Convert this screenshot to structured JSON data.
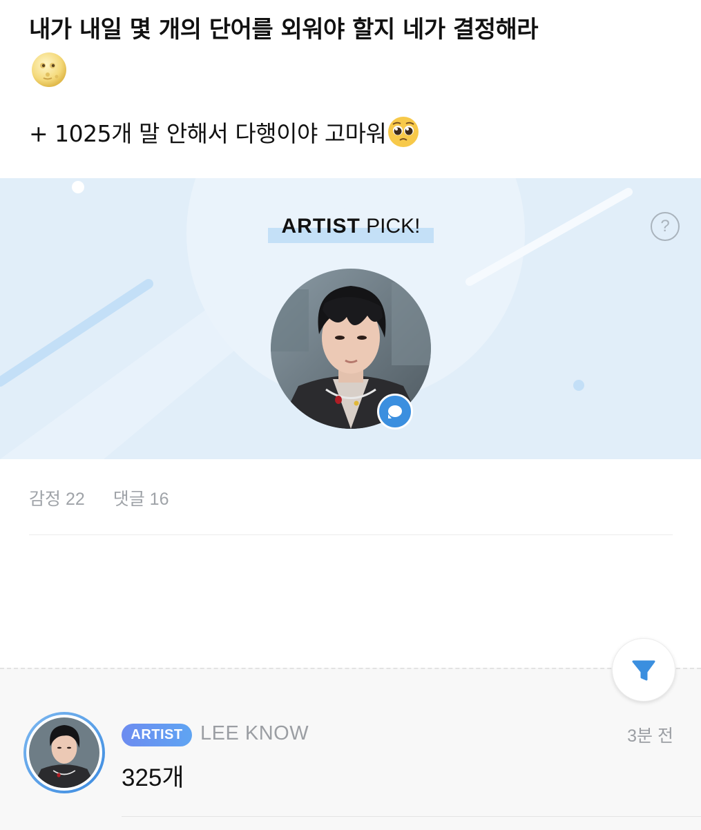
{
  "post": {
    "title": "내가 내일 몇 개의 단어를 외워야 할지 네가 결정해라",
    "title_emoji": "new-moon-with-face-icon",
    "note": "+ 1025개 말 안해서 다행이야 고마워",
    "note_emoji": "pleading-face-icon"
  },
  "artist_pick": {
    "title_bold": "ARTIST",
    "title_rest": " PICK!",
    "help_label": "?",
    "avatar": "artist-photo",
    "badge_icon": "chat-bubble-icon"
  },
  "stats": {
    "emotions": "감정 22",
    "comments": "댓글 16"
  },
  "filter": {
    "icon": "filter-icon"
  },
  "comment": {
    "badge": "ARTIST",
    "author": "LEE KNOW",
    "time": "3분 전",
    "text": "325개"
  },
  "colors": {
    "banner_bg": "#e1eef9",
    "accent_blue": "#3b8fdf",
    "badge_gradient_start": "#6d8cf0",
    "badge_gradient_end": "#5fa4f2",
    "muted_text": "#9b9ea3"
  }
}
